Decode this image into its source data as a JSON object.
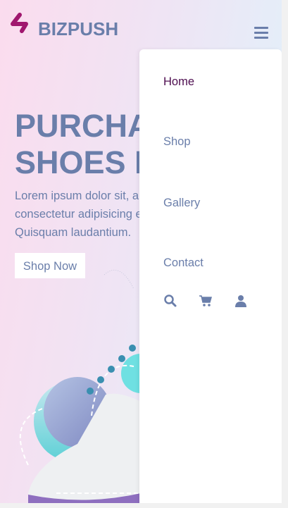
{
  "brand": {
    "name": "BIZPUSH",
    "logo_color": "#a0176e",
    "text_color": "#6a7eaa"
  },
  "hero": {
    "title_line1": "PURCHASE",
    "title_line2": "SHOES NOW",
    "text": "Lorem ipsum dolor sit, amet consectetur adipisicing elit. Quisquam laudantium.",
    "cta_label": "Shop Now"
  },
  "menu": {
    "items": [
      {
        "label": "Home",
        "active": true
      },
      {
        "label": "Shop"
      },
      {
        "label": "Gallery"
      },
      {
        "label": "Contact"
      }
    ],
    "icons": [
      "search-icon",
      "cart-icon",
      "user-icon"
    ]
  },
  "colors": {
    "accent": "#6a7eaa",
    "active": "#4d0c4f"
  }
}
